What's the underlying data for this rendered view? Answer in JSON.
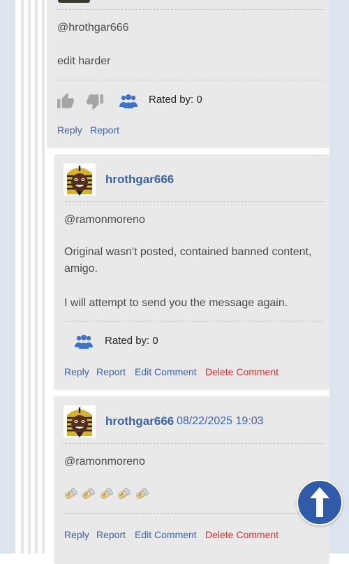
{
  "comments": [
    {
      "mention": "@hrothgar666",
      "body": [
        "edit harder"
      ],
      "rating_label": "Rated by: 0",
      "actions": {
        "reply": "Reply",
        "report": "Report"
      }
    },
    {
      "author": "hrothgar666",
      "mention": "@ramonmoreno",
      "body": [
        "Original wasn't posted, contained banned content, amigo.",
        "I will attempt to send you the message again."
      ],
      "rating_label": "Rated by: 0",
      "actions": {
        "reply": "Reply",
        "report": "Report",
        "edit": "Edit Comment",
        "delete": "Delete Comment"
      }
    },
    {
      "author": "hrothgar666",
      "date": "08/22/2025 19:03",
      "mention": "@ramonmoreno",
      "emoji_count": 5,
      "actions": {
        "reply": "Reply",
        "report": "Report",
        "edit": "Edit Comment",
        "delete": "Delete Comment"
      }
    }
  ],
  "icons": {
    "thumbs_up": "thumbs-up-icon",
    "thumbs_down": "thumbs-down-icon",
    "raters": "users-group-icon",
    "scroll_top": "arrow-up-icon",
    "emoji": "burrito-emoji-icon"
  },
  "colors": {
    "link": "#3a63a8",
    "delete": "#d9302c",
    "card_bg": "#e9e9e9",
    "scroll_button": "#2f5ba8"
  }
}
